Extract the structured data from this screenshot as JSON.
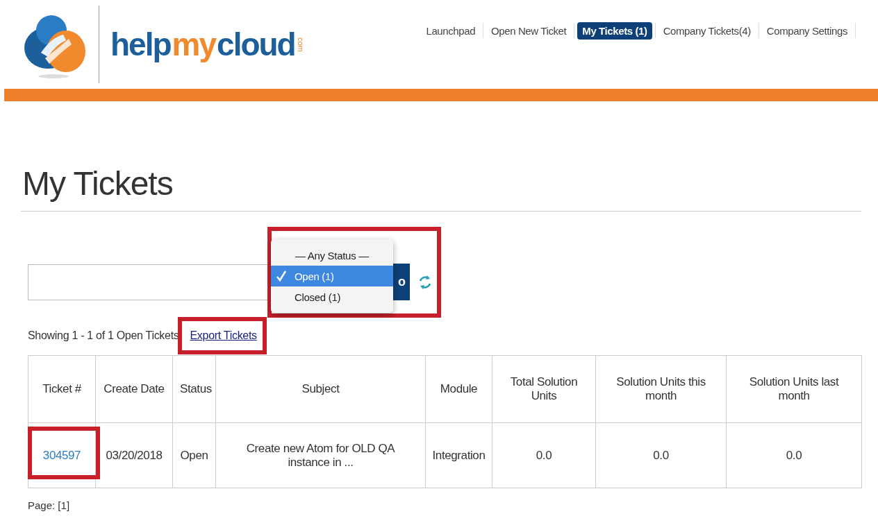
{
  "logo": {
    "parts": [
      {
        "text": "help",
        "color": "#1d5f9a"
      },
      {
        "text": "my",
        "color": "#f08a2c"
      },
      {
        "text": "cloud",
        "color": "#1d5f9a"
      }
    ],
    "suffix": "com"
  },
  "nav": [
    {
      "label": "Launchpad",
      "selected": false
    },
    {
      "label": "Open New Ticket",
      "selected": false
    },
    {
      "label": "My Tickets (1)",
      "selected": true
    },
    {
      "label": "Company Tickets(4)",
      "selected": false
    },
    {
      "label": "Company Settings",
      "selected": false
    }
  ],
  "page_title": "My Tickets",
  "search": {
    "go_button": "o"
  },
  "status_menu": [
    {
      "label": "— Any Status —",
      "selected": false
    },
    {
      "label": "Open (1)",
      "selected": true
    },
    {
      "label": "Closed (1)",
      "selected": false
    }
  ],
  "summary": "Showing 1 - 1 of 1 Open Tickets",
  "export_link": "Export Tickets",
  "table": {
    "columns": [
      "Ticket #",
      "Create Date",
      "Status",
      "Subject",
      "Module",
      "Total Solution Units",
      "Solution Units this month",
      "Solution Units last month"
    ],
    "rows": [
      {
        "cells": [
          "304597",
          "03/20/2018",
          "Open",
          "Create new Atom for OLD QA instance in ...",
          "Integration",
          "0.0",
          "0.0",
          "0.0"
        ]
      }
    ]
  },
  "pager": "Page: [1]"
}
